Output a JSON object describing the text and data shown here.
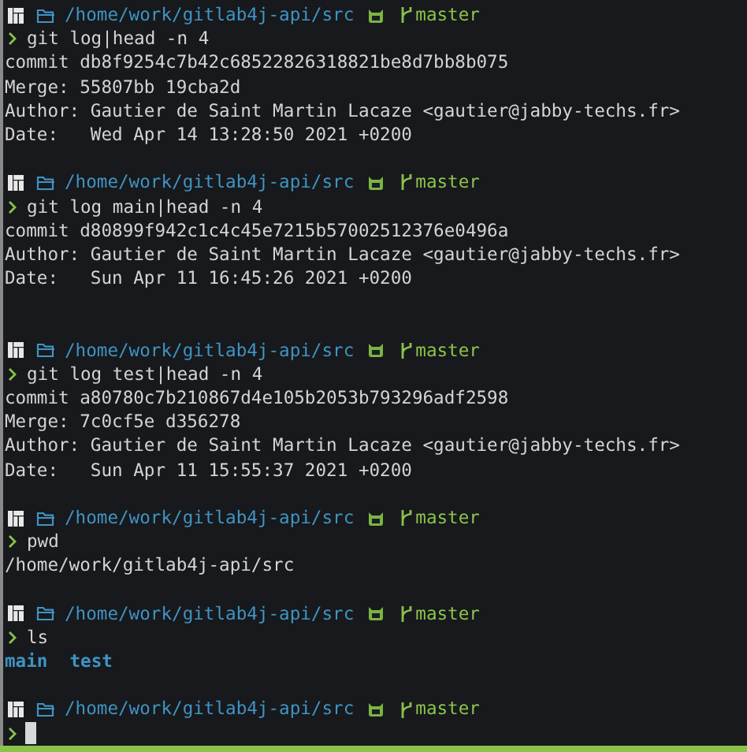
{
  "blocks": [
    {
      "prompt": {
        "path": "/home/work/gitlab4j-api/src",
        "branch": "master"
      },
      "command": "git log|head -n 4",
      "output": [
        {
          "kind": "text",
          "text": "commit db8f9254c7b42c68522826318821be8d7bb8b075"
        },
        {
          "kind": "text",
          "text": "Merge: 55807bb 19cba2d"
        },
        {
          "kind": "text",
          "text": "Author: Gautier de Saint Martin Lacaze <gautier@jabby-techs.fr>"
        },
        {
          "kind": "text",
          "text": "Date:   Wed Apr 14 13:28:50 2021 +0200"
        }
      ]
    },
    {
      "prompt": {
        "path": "/home/work/gitlab4j-api/src",
        "branch": "master"
      },
      "command": "git log main|head -n 4",
      "output": [
        {
          "kind": "text",
          "text": "commit d80899f942c1c4c45e7215b57002512376e0496a"
        },
        {
          "kind": "text",
          "text": "Author: Gautier de Saint Martin Lacaze <gautier@jabby-techs.fr>"
        },
        {
          "kind": "text",
          "text": "Date:   Sun Apr 11 16:45:26 2021 +0200"
        },
        {
          "kind": "blank"
        }
      ]
    },
    {
      "prompt": {
        "path": "/home/work/gitlab4j-api/src",
        "branch": "master"
      },
      "command": "git log test|head -n 4",
      "output": [
        {
          "kind": "text",
          "text": "commit a80780c7b210867d4e105b2053b793296adf2598"
        },
        {
          "kind": "text",
          "text": "Merge: 7c0cf5e d356278"
        },
        {
          "kind": "text",
          "text": "Author: Gautier de Saint Martin Lacaze <gautier@jabby-techs.fr>"
        },
        {
          "kind": "text",
          "text": "Date:   Sun Apr 11 15:55:37 2021 +0200"
        }
      ]
    },
    {
      "prompt": {
        "path": "/home/work/gitlab4j-api/src",
        "branch": "master"
      },
      "command": "pwd",
      "output": [
        {
          "kind": "text",
          "text": "/home/work/gitlab4j-api/src"
        }
      ]
    },
    {
      "prompt": {
        "path": "/home/work/gitlab4j-api/src",
        "branch": "master"
      },
      "command": "ls",
      "output": [
        {
          "kind": "dirs",
          "entries": [
            "main",
            "test"
          ]
        }
      ]
    },
    {
      "prompt": {
        "path": "/home/work/gitlab4j-api/src",
        "branch": "master"
      },
      "cursor": true
    }
  ]
}
